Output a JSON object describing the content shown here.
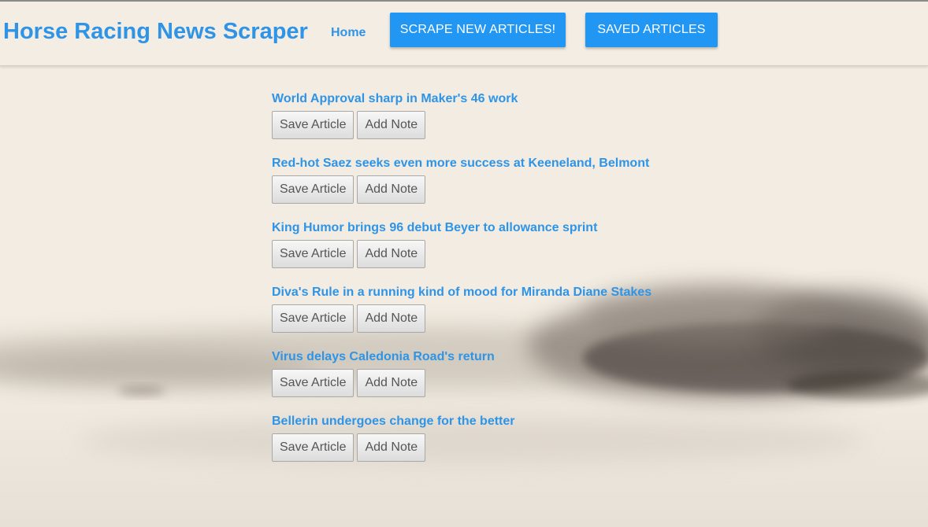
{
  "navbar": {
    "brand": "Horse Racing News Scraper",
    "home_label": "Home",
    "scrape_label": "SCRAPE NEW ARTICLES!",
    "saved_label": "SAVED ARTICLES"
  },
  "article_actions": {
    "save_label": "Save Article",
    "note_label": "Add Note"
  },
  "articles": [
    {
      "title": "World Approval sharp in Maker's 46 work"
    },
    {
      "title": "Red-hot Saez seeks even more success at Keeneland, Belmont"
    },
    {
      "title": "King Humor brings 96 debut Beyer to allowance sprint"
    },
    {
      "title": "Diva's Rule in a running kind of mood for Miranda Diane Stakes"
    },
    {
      "title": "Virus delays Caledonia Road's return"
    },
    {
      "title": "Bellerin undergoes change for the better"
    }
  ],
  "colors": {
    "brand_blue": "#2f94e6",
    "button_blue": "#2196f3",
    "page_background": "#f2ece2"
  },
  "background_image": "blurred-racehorse-photo"
}
